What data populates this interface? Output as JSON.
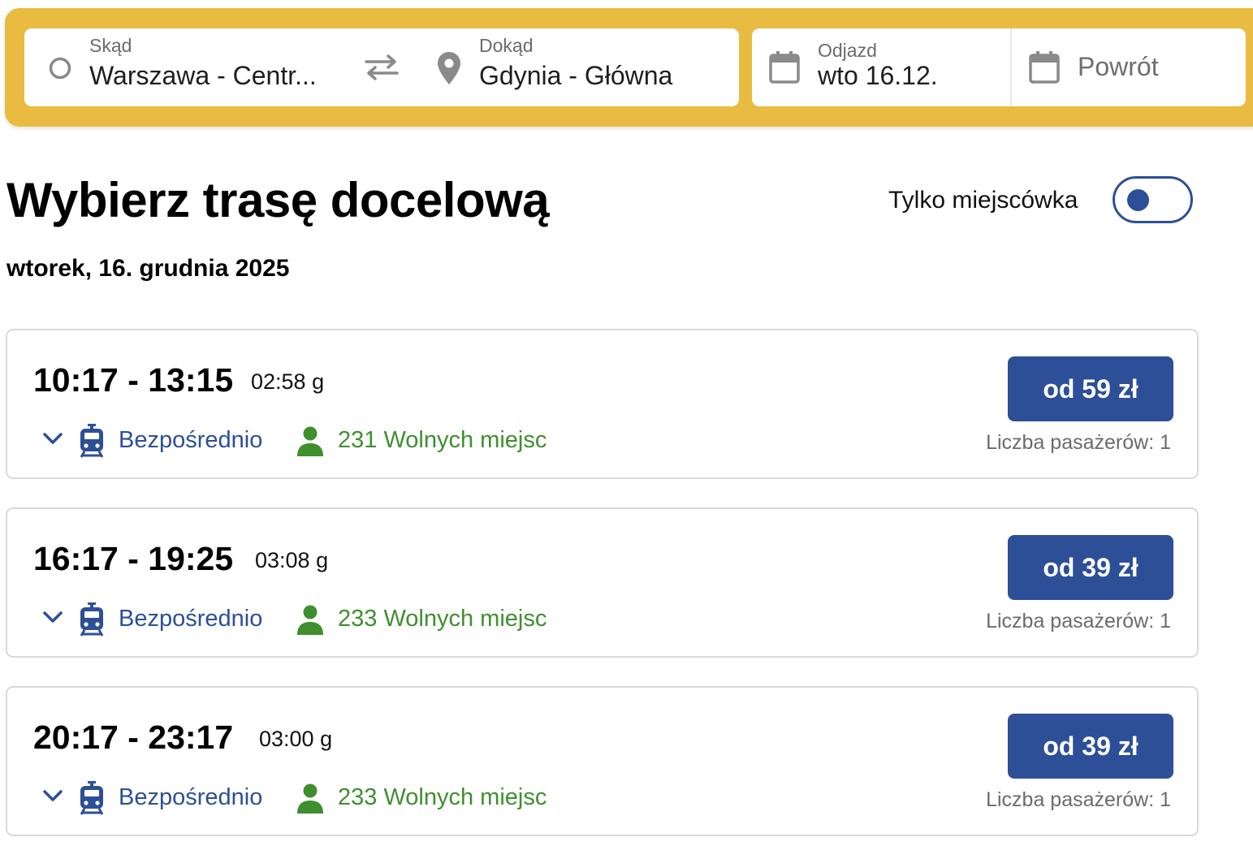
{
  "search": {
    "from_label": "Skąd",
    "from_value": "Warszawa - Centr...",
    "to_label": "Dokąd",
    "to_value": "Gdynia - Główna",
    "departure_label": "Odjazd",
    "departure_value": "wto 16.12.",
    "return_placeholder": "Powrót"
  },
  "page": {
    "title": "Wybierz trasę docelową",
    "toggle_label": "Tylko miejscówka",
    "date_heading": "wtorek, 16. grudnia 2025"
  },
  "connections": [
    {
      "times": "10:17 - 13:15",
      "duration": "02:58 g",
      "type": "Bezpośrednio",
      "seats": "231 Wolnych miejsc",
      "price": "od 59 zł",
      "passengers": "Liczba pasażerów: 1"
    },
    {
      "times": "16:17 - 19:25",
      "duration": "03:08 g",
      "type": "Bezpośrednio",
      "seats": "233 Wolnych miejsc",
      "price": "od 39 zł",
      "passengers": "Liczba pasażerów: 1"
    },
    {
      "times": "20:17 - 23:17",
      "duration": "03:00 g",
      "type": "Bezpośrednio",
      "seats": "233 Wolnych miejsc",
      "price": "od 39 zł",
      "passengers": "Liczba pasażerów: 1"
    }
  ],
  "colors": {
    "accent_yellow": "#e9bb40",
    "primary_blue": "#2d4f97",
    "seats_green": "#3f8f2f",
    "muted_gray": "#6b6b6b"
  },
  "icons": {
    "origin": "circle-outline-icon",
    "swap": "swap-arrows-icon",
    "destination": "location-pin-icon",
    "date": "calendar-icon",
    "expand": "chevron-down-icon",
    "train": "train-icon",
    "seats": "person-icon"
  }
}
